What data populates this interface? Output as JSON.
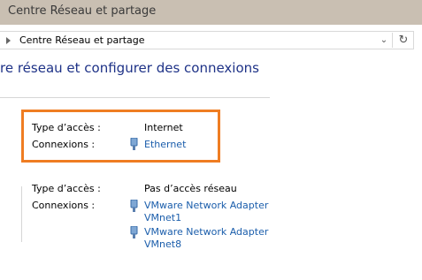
{
  "window": {
    "title": "Centre Réseau et partage"
  },
  "address_bar": {
    "breadcrumb": "Centre Réseau et partage"
  },
  "page": {
    "heading": "re réseau et configurer des connexions"
  },
  "networks": [
    {
      "access_type_label": "Type d’accès :",
      "access_type_value": "Internet",
      "connections_label": "Connexions :",
      "connections": [
        "Ethernet"
      ]
    },
    {
      "access_type_label": "Type d’accès :",
      "access_type_value": "Pas d’accès réseau",
      "connections_label": "Connexions :",
      "connections": [
        {
          "line1": "VMware Network Adapter",
          "line2": "VMnet1"
        },
        {
          "line1": "VMware Network Adapter",
          "line2": "VMnet8"
        }
      ]
    }
  ],
  "colors": {
    "title_bar": "#c9bfb2",
    "heading": "#1e3287",
    "link": "#1a5dab",
    "highlight": "#ef7d22"
  },
  "icons": [
    "chevron-right-icon",
    "chevron-down-icon",
    "refresh-icon",
    "ethernet-plug-icon"
  ]
}
